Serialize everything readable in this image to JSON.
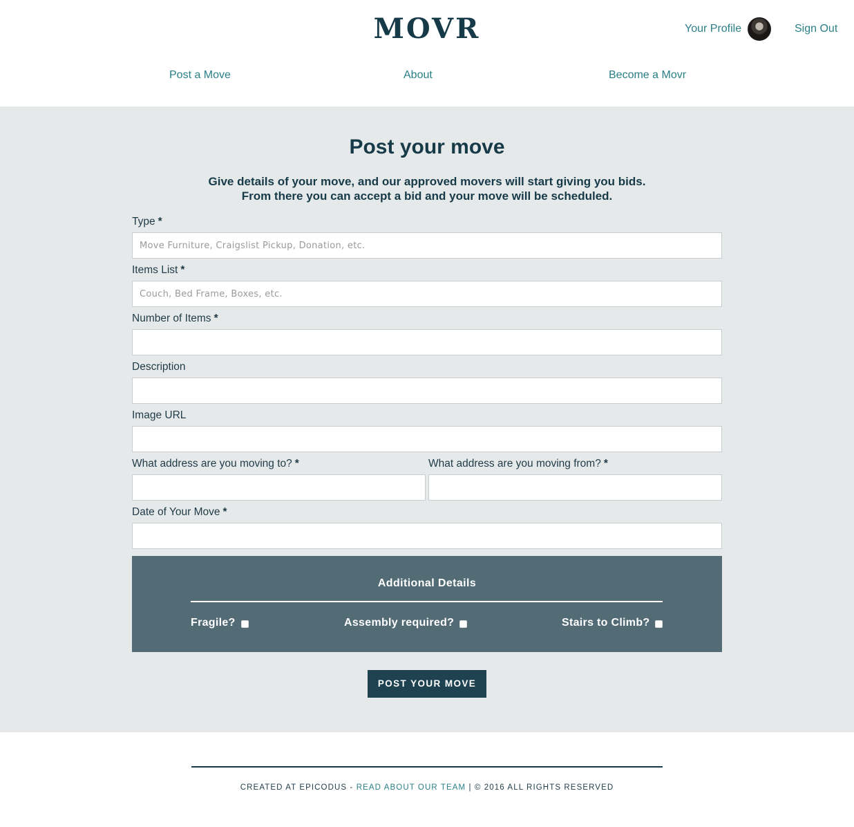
{
  "header": {
    "logo": "MOVR",
    "profile_label": "Your Profile",
    "signout_label": "Sign Out"
  },
  "nav": {
    "post_move": "Post a Move",
    "about": "About",
    "become_movr": "Become a Movr"
  },
  "page": {
    "title": "Post your move",
    "intro_line1": "Give details of your move, and our approved movers will start giving you bids.",
    "intro_line2": "From there you can accept a bid and your move will be scheduled."
  },
  "form": {
    "required_marker": "*",
    "type": {
      "label": "Type",
      "placeholder": "Move Furniture, Craigslist Pickup, Donation, etc.",
      "value": ""
    },
    "items_list": {
      "label": "Items List",
      "placeholder": "Couch, Bed Frame, Boxes, etc.",
      "value": ""
    },
    "number_of_items": {
      "label": "Number of Items",
      "value": ""
    },
    "description": {
      "label": "Description",
      "value": ""
    },
    "image_url": {
      "label": "Image URL",
      "value": ""
    },
    "address_to": {
      "label": "What address are you moving to?",
      "value": ""
    },
    "address_from": {
      "label": "What address are you moving from?",
      "value": ""
    },
    "move_date": {
      "label": "Date of Your Move",
      "value": ""
    }
  },
  "additional_details": {
    "title": "Additional Details",
    "fragile": {
      "label": "Fragile?",
      "checked": false
    },
    "assembly": {
      "label": "Assembly required?",
      "checked": false
    },
    "stairs": {
      "label": "Stairs to Climb?",
      "checked": false
    }
  },
  "submit_label": "POST YOUR MOVE",
  "footer": {
    "created_at": "CREATED AT EPICODUS - ",
    "team_link": "READ ABOUT OUR TEAM",
    "rights": " | © 2016 ALL RIGHTS RESERVED"
  },
  "colors": {
    "brand_dark": "#173a48",
    "link_teal": "#2a7f86",
    "panel_slate": "#536b75",
    "page_gray": "#e6e9ea",
    "button_dark": "#1e4250"
  }
}
